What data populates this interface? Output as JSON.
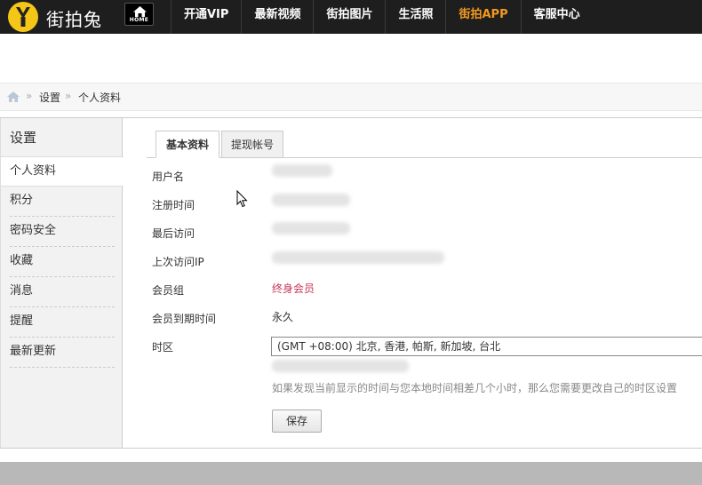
{
  "header": {
    "brand": "街拍兔",
    "home_label": "HOME",
    "nav": [
      {
        "label": "开通VIP",
        "active": false
      },
      {
        "label": "最新视频",
        "active": false
      },
      {
        "label": "街拍图片",
        "active": false
      },
      {
        "label": "生活照",
        "active": false
      },
      {
        "label": "街拍APP",
        "active": true
      },
      {
        "label": "客服中心",
        "active": false
      }
    ]
  },
  "breadcrumb": {
    "sep": "»",
    "items": [
      "设置",
      "个人资料"
    ]
  },
  "sidebar": {
    "title": "设置",
    "current": "个人资料",
    "items": [
      "积分",
      "密码安全",
      "收藏",
      "消息",
      "提醒",
      "最新更新"
    ]
  },
  "tabs": {
    "active": "基本资料",
    "other": "提现帐号"
  },
  "form": {
    "username_label": "用户名",
    "register_label": "注册时间",
    "last_visit_label": "最后访问",
    "last_ip_label": "上次访问IP",
    "group_label": "会员组",
    "group_value": "终身会员",
    "expire_label": "会员到期时间",
    "expire_value": "永久",
    "timezone_label": "时区",
    "timezone_value": "(GMT +08:00) 北京, 香港, 帕斯, 新加坡, 台北",
    "timezone_hint": "如果发现当前显示的时间与您本地时间相差几个小时，那么您需要更改自己的时区设置",
    "save_label": "保存"
  },
  "colors": {
    "topbar": "#1e1e1e",
    "nav_active": "#f39a1e",
    "member_group": "#c8355a",
    "brand_yellow": "#f5c518"
  }
}
